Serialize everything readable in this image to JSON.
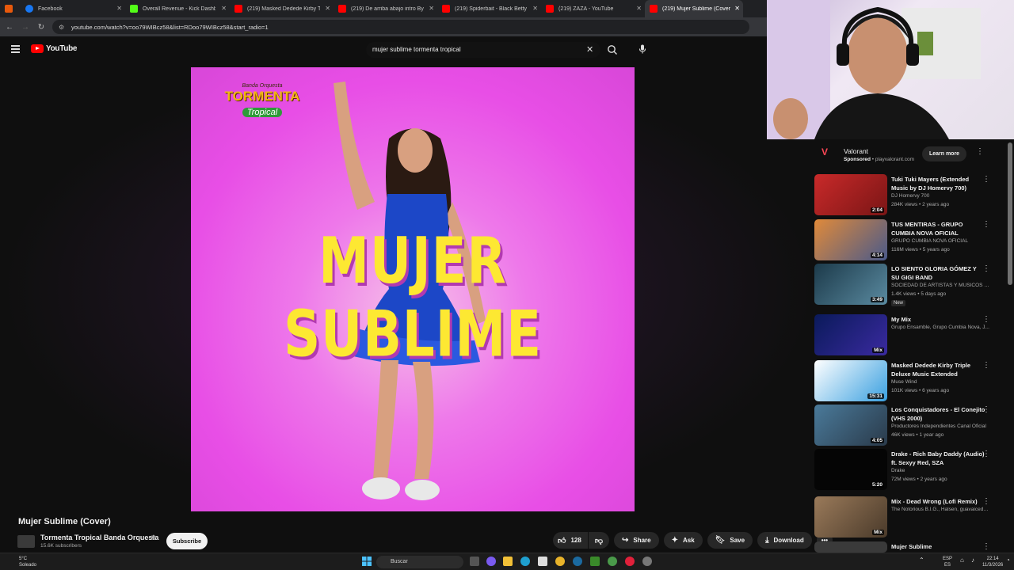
{
  "browser": {
    "tabs": [
      {
        "label": "",
        "color": "#e8590c"
      },
      {
        "label": "Facebook",
        "color": "#1877f2"
      },
      {
        "label": "Overall Revenue - Kick Dashbo",
        "color": "#53fc18"
      },
      {
        "label": "(219) Masked Dedede Kirby Trip",
        "color": "#ff0000"
      },
      {
        "label": "(219) De arriba abajo intro Byra",
        "color": "#ff0000"
      },
      {
        "label": "(219) Spiderbait - Black Betty (",
        "color": "#ff0000"
      },
      {
        "label": "(219) ZAZA - YouTube",
        "color": "#ff0000"
      },
      {
        "label": "(219) Mujer Sublime (Cover",
        "color": "#ff0000"
      }
    ],
    "url": "youtube.com/watch?v=oo79WIBcz58&list=RDoo79WIBcz58&start_radio=1"
  },
  "header": {
    "logo_text": "YouTube",
    "search_value": "mujer sublime tormenta tropical",
    "icons": [
      "menu-icon",
      "clear-icon",
      "search-icon",
      "mic-icon"
    ]
  },
  "thumbnail": {
    "brand_top": "Banda Orquesta",
    "brand_main": "TORMENTA",
    "brand_sub": "Tropical",
    "title_art": "MUJER SUBLIME",
    "accent_pink": "#e84ee6",
    "accent_yellow": "#fde832"
  },
  "video": {
    "title": "Mujer Sublime (Cover)",
    "channel": "Tormenta Tropical Banda Orquesta",
    "subscribers": "15.6K subscribers",
    "subscribe_label": "Subscribe",
    "likes": "128",
    "share_label": "Share",
    "ask_label": "Ask",
    "save_label": "Save",
    "download_label": "Download"
  },
  "sidebar": {
    "ad": {
      "title": "Valorant",
      "sponsored": "Sponsored",
      "domain": "playvalorant.com",
      "cta": "Learn more"
    },
    "items": [
      {
        "title": "Tuki Tuki Mayers (Extended Music by DJ Homervy 700)",
        "channel": "DJ Homervy 700",
        "meta": "284K views • 2 years ago",
        "duration": "2:04",
        "thumb": "#b8262b",
        "new": ""
      },
      {
        "title": "TUS MENTIRAS - GRUPO CUMBIA NOVA OFICIAL",
        "channel": "GRUPO CUMBIA NOVA OFICIAL",
        "meta": "116M views • 5 years ago",
        "duration": "4:14",
        "thumb": "#c96c2e",
        "new": ""
      },
      {
        "title": "LO SIENTO   GLORIA GÓMEZ Y SU GIGI BAND",
        "channel": "SOCIEDAD DE ARTISTAS Y MÚSICOS DE...",
        "meta": "1.4K views • 5 days ago",
        "duration": "3:49",
        "thumb": "#2e5b6e",
        "new": "New"
      },
      {
        "title": "My Mix",
        "channel": "Grupo Ensamble, Grupo Cumbia Nova, J...",
        "meta": "",
        "duration": "Mix",
        "thumb": "#1a2a7a",
        "new": ""
      },
      {
        "title": "Masked Dedede  Kirby Triple Deluxe Music Extended",
        "channel": "Muse Wind",
        "meta": "101K views • 6 years ago",
        "duration": "15:31",
        "thumb": "#3aa0e0",
        "new": ""
      },
      {
        "title": "Los Conquistadores - El Conejito (VHS 2000)",
        "channel": "Productores Independientes Canal Oficial",
        "meta": "46K views • 1 year ago",
        "duration": "4:05",
        "thumb": "#3c6e8a",
        "new": ""
      },
      {
        "title": "Drake - Rich Baby Daddy (Audio) ft. Sexyy Red, SZA",
        "channel": "Drake",
        "meta": "72M views • 2 years ago",
        "duration": "5:20",
        "thumb": "#0a0a0a",
        "new": ""
      },
      {
        "title": "Mix - Dead Wrong (Lofi Remix)",
        "channel": "The Notorious B.I.G., Halsen, guavaiced, ...",
        "meta": "",
        "duration": "Mix",
        "thumb": "#7a6048",
        "new": ""
      },
      {
        "title": "Mujer Sublime",
        "channel": "",
        "meta": "",
        "duration": "",
        "thumb": "#3a3a3a",
        "new": ""
      }
    ]
  },
  "taskbar": {
    "temp": "5°C",
    "weather": "Soleado",
    "search_placeholder": "Buscar",
    "lang1": "ESP",
    "lang2": "ES",
    "time": "22:14",
    "date": "11/3/2026"
  }
}
